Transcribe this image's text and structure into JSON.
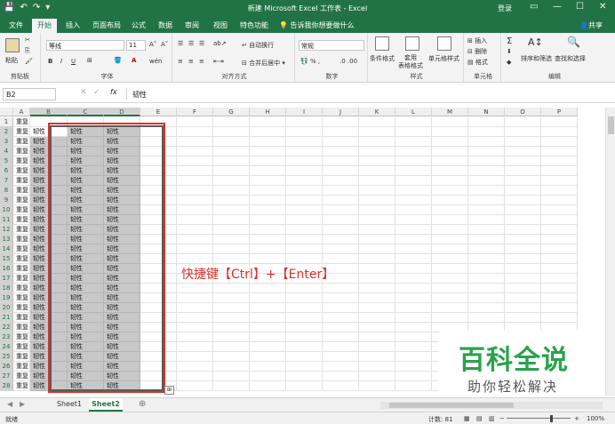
{
  "titlebar": {
    "title": "新建 Microsoft Excel 工作表 - Excel",
    "signin": "登录",
    "qat": [
      "💾",
      "↶",
      "↷",
      "▾"
    ],
    "controls": [
      "▭",
      "—",
      "☐",
      "✕"
    ]
  },
  "tabs": [
    "文件",
    "开始",
    "插入",
    "页面布局",
    "公式",
    "数据",
    "审阅",
    "视图",
    "特色功能"
  ],
  "tell_me": "告诉我你想要做什么",
  "share": "共享",
  "ribbon": {
    "clipboard": {
      "paste": "粘贴",
      "label": "剪贴板"
    },
    "font": {
      "name": "等线",
      "size": "11",
      "grow": "A˄",
      "shrink": "A˅",
      "bold": "B",
      "italic": "I",
      "underline": "U",
      "color_a": "A",
      "phonetic": "wén",
      "label": "字体"
    },
    "alignment": {
      "wrap": "自动换行",
      "merge": "合并后居中",
      "label": "对齐方式"
    },
    "number": {
      "format": "常规",
      "label": "数字"
    },
    "styles": {
      "conditional": "条件格式",
      "table": "套用\n表格格式",
      "cell": "单元格样式",
      "label": "样式"
    },
    "cells": {
      "insert": "插入",
      "delete": "删除",
      "format": "格式",
      "label": "单元格"
    },
    "editing": {
      "sum": "Σ",
      "sort": "排序和筛选",
      "find": "查找和选择",
      "label": "编辑"
    }
  },
  "namebox": "B2",
  "fx": "fx",
  "formula": "韧性",
  "columns": [
    "A",
    "B",
    "C",
    "D",
    "E",
    "F",
    "G",
    "H",
    "I",
    "J",
    "K",
    "L",
    "M",
    "N",
    "O",
    "P"
  ],
  "rows": [
    "1",
    "2",
    "3",
    "4",
    "5",
    "6",
    "7",
    "8",
    "9",
    "10",
    "11",
    "12",
    "13",
    "14",
    "15",
    "16",
    "17",
    "18",
    "19",
    "20",
    "21",
    "22",
    "23",
    "24",
    "25",
    "26",
    "27",
    "28"
  ],
  "col_a_value": "重复",
  "fill_value": "韧性",
  "annotation": "快捷键【Ctrl】+【Enter】",
  "watermark": {
    "title": "百科全说",
    "subtitle": "助你轻松解决"
  },
  "sheets": [
    "Sheet1",
    "Sheet2"
  ],
  "add_sheet": "⊕",
  "status": {
    "ready": "就绪",
    "count": "计数: 81",
    "zoom": "100%"
  },
  "colors": {
    "accent": "#217346",
    "highlight_red": "#d9322c",
    "watermark_green": "#2aa24a"
  }
}
